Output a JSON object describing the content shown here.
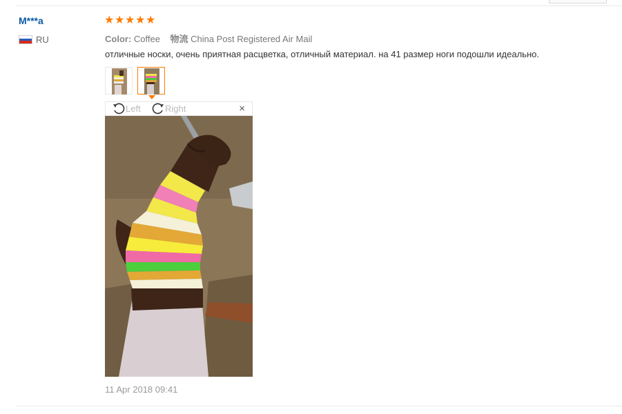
{
  "review": {
    "user_name": "M***a",
    "country": "RU",
    "rating": 5,
    "meta": {
      "color_label": "Color:",
      "color_value": "Coffee",
      "shipping_label": "物流",
      "shipping_value": "China Post Registered Air Mail"
    },
    "comment": "отличные носки, очень приятная расцветка, отличный материал. на 41 размер ноги подошли идеально.",
    "thumbnails": 2,
    "selected_thumbnail": 2,
    "viewer": {
      "rotate_left_label": "Left",
      "rotate_right_label": "Right",
      "close_glyph": "×"
    },
    "date": "11 Apr 2018 09:41"
  },
  "colors": {
    "accent": "#ff7a00",
    "username": "#0b5aa6",
    "muted_text": "#999999"
  },
  "icons": [
    "flag-ru-icon",
    "star-icon",
    "rotate-left-icon",
    "rotate-right-icon",
    "close-icon"
  ]
}
